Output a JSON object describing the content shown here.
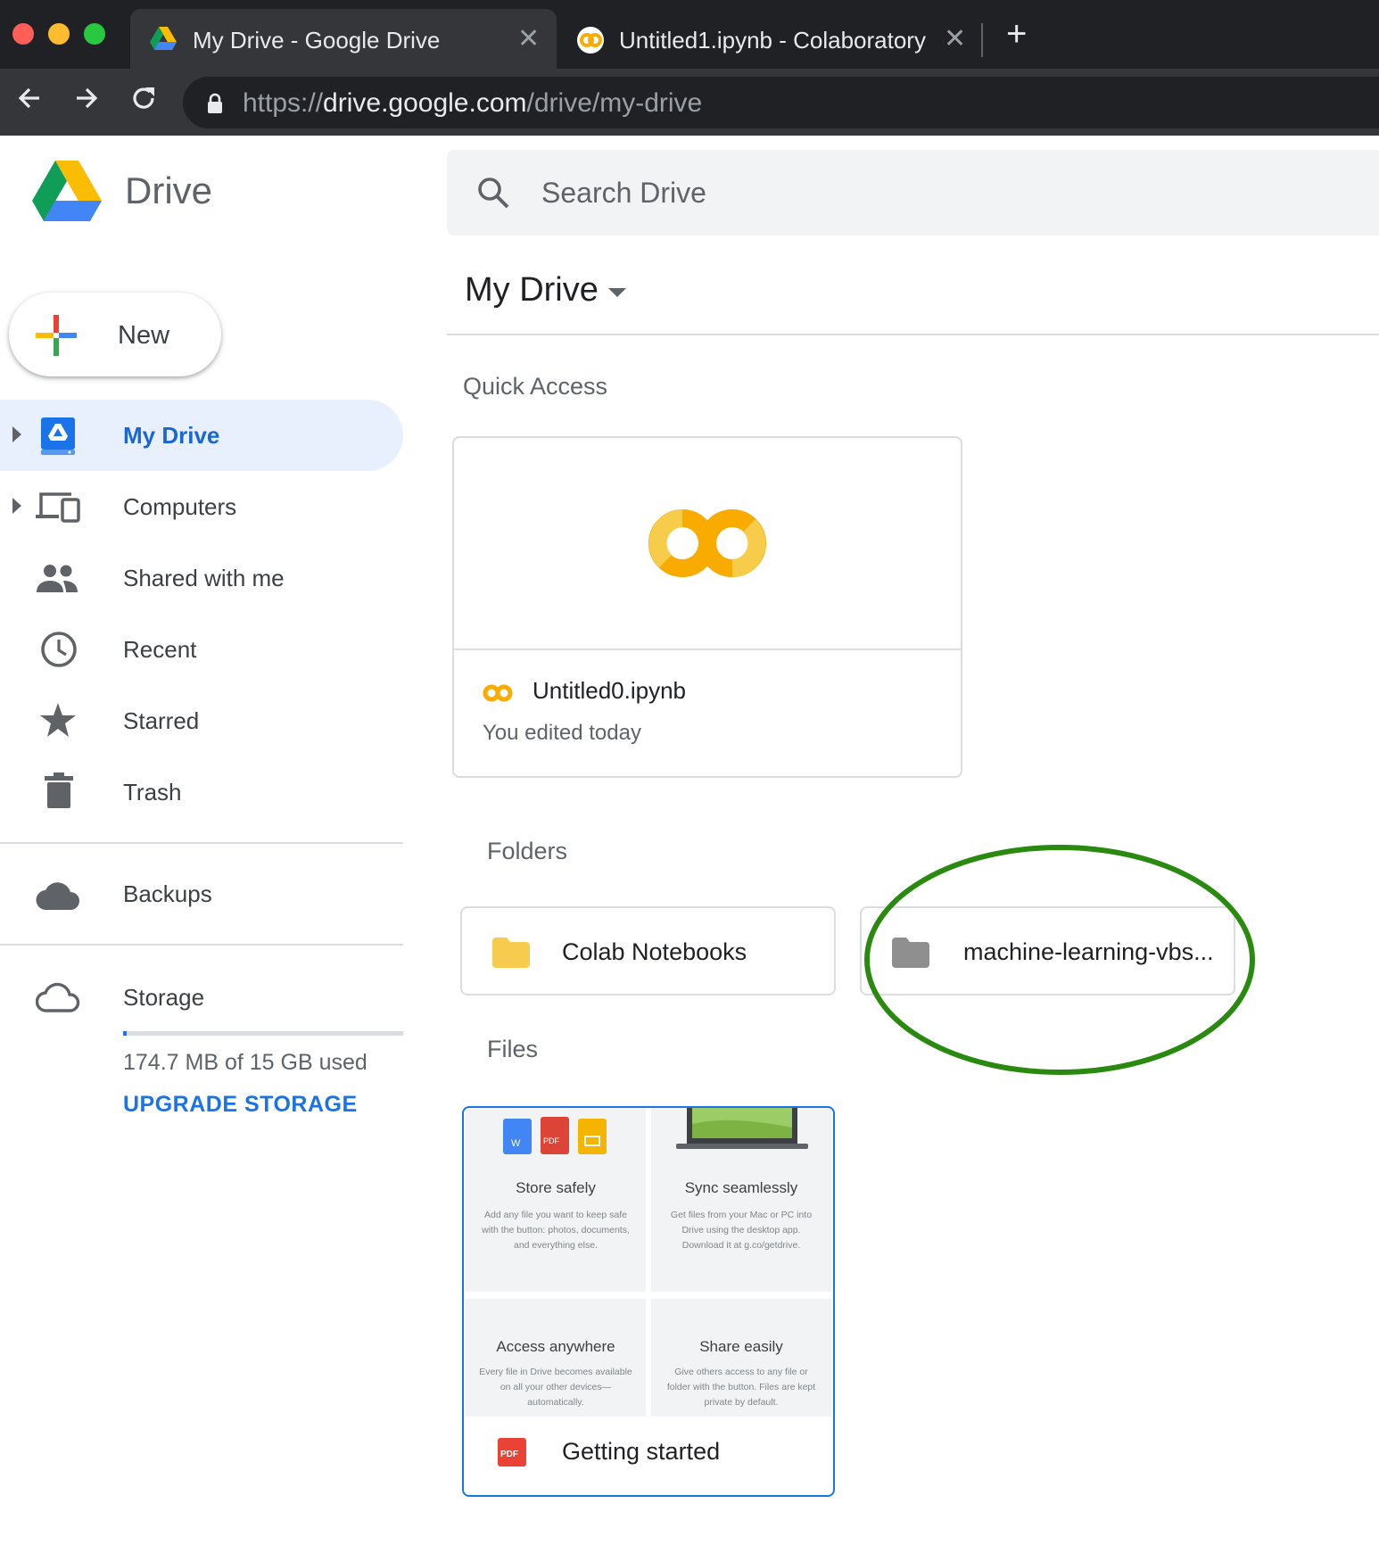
{
  "browser": {
    "tabs": [
      {
        "title": "My Drive - Google Drive",
        "active": true
      },
      {
        "title": "Untitled1.ipynb - Colaboratory",
        "active": false
      }
    ],
    "url_scheme": "https://",
    "url_host": "drive.google.com",
    "url_path": "/drive/my-drive"
  },
  "app": {
    "name": "Drive"
  },
  "search": {
    "placeholder": "Search Drive"
  },
  "sidebar": {
    "new_label": "New",
    "items": [
      {
        "label": "My Drive",
        "icon": "my-drive-icon",
        "active": true
      },
      {
        "label": "Computers",
        "icon": "computers-icon"
      },
      {
        "label": "Shared with me",
        "icon": "shared-icon"
      },
      {
        "label": "Recent",
        "icon": "clock-icon"
      },
      {
        "label": "Starred",
        "icon": "star-icon"
      },
      {
        "label": "Trash",
        "icon": "trash-icon"
      },
      {
        "label": "Backups",
        "icon": "cloud-icon"
      },
      {
        "label": "Storage",
        "icon": "cloud-outline-icon"
      }
    ],
    "storage": {
      "used_text": "174.7 MB of 15 GB used",
      "used_fraction": 0.012,
      "upgrade_label": "UPGRADE STORAGE"
    }
  },
  "main": {
    "title": "My Drive",
    "quick_access": {
      "heading": "Quick Access",
      "items": [
        {
          "name": "Untitled0.ipynb",
          "meta": "You edited today",
          "icon": "colab-icon"
        }
      ]
    },
    "folders": {
      "heading": "Folders",
      "items": [
        {
          "name": "Colab Notebooks",
          "icon": "folder-icon",
          "color": "#f7cb4d"
        },
        {
          "name": "machine-learning-vbs...",
          "icon": "folder-icon",
          "color": "#8f8f8f"
        }
      ]
    },
    "files": {
      "heading": "Files",
      "items": [
        {
          "name": "Getting started",
          "icon": "pdf-icon",
          "thumbnail": [
            {
              "heading": "Store safely",
              "text": "Add any file you want to keep safe with the  button: photos, documents, and everything else."
            },
            {
              "heading": "Sync seamlessly",
              "text": "Get files from your Mac or PC into Drive using the desktop app. Download it at g.co/getdrive."
            },
            {
              "heading": "Access anywhere",
              "text": "Every file in Drive becomes available on all your other devices—automatically."
            },
            {
              "heading": "Share easily",
              "text": "Give others access to any file or folder with the  button. Files are kept private by default."
            }
          ]
        }
      ]
    }
  },
  "colors": {
    "accent": "#1a73e8",
    "active_bg": "#e8f0fe",
    "highlight_ring": "#2a8a10"
  }
}
